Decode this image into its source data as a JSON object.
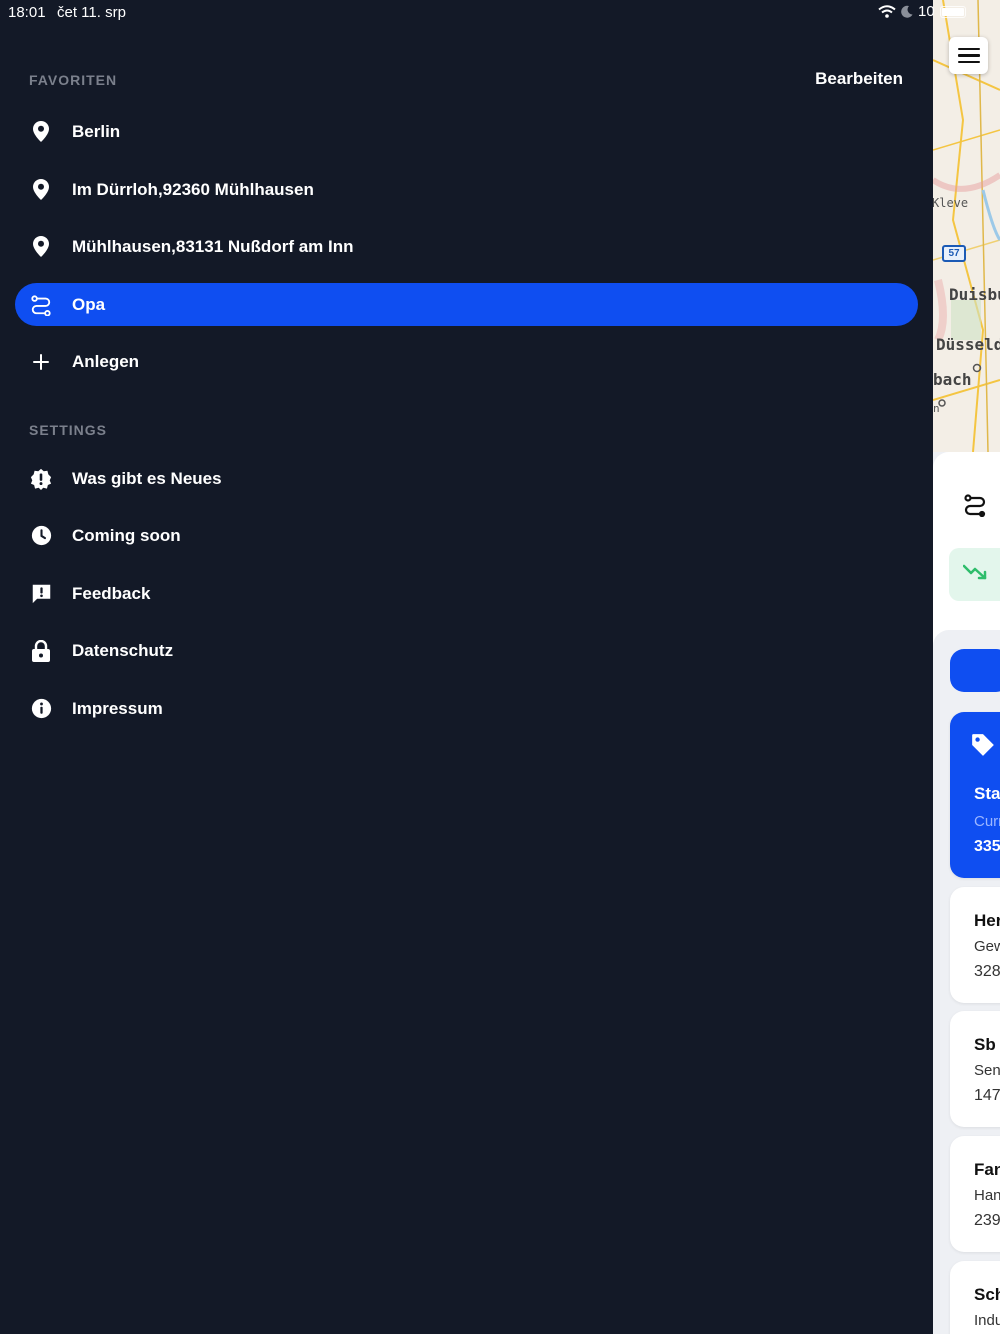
{
  "status_bar": {
    "time": "18:01",
    "date": "čet 11. srp",
    "battery_text": "10"
  },
  "favorites": {
    "header": "FAVORITEN",
    "edit_label": "Bearbeiten",
    "items": [
      {
        "label": "Berlin",
        "icon": "location-pin-icon"
      },
      {
        "label": "Im Dürrloh,92360 Mühlhausen",
        "icon": "location-pin-icon"
      },
      {
        "label": "Mühlhausen,83131 Nußdorf am Inn",
        "icon": "location-pin-icon"
      },
      {
        "label": "Opa",
        "icon": "route-icon",
        "active": true
      },
      {
        "label": "Anlegen",
        "icon": "plus-icon"
      }
    ]
  },
  "settings": {
    "header": "SETTINGS",
    "items": [
      {
        "label": "Was gibt es Neues",
        "icon": "new-badge-icon"
      },
      {
        "label": "Coming soon",
        "icon": "clock-icon"
      },
      {
        "label": "Feedback",
        "icon": "feedback-icon"
      },
      {
        "label": "Datenschutz",
        "icon": "lock-icon"
      },
      {
        "label": "Impressum",
        "icon": "info-icon"
      }
    ]
  },
  "background_app": {
    "map_labels": [
      "Kleve",
      "Duisbu",
      "Düsseld",
      "bach",
      "n"
    ],
    "road_number": "57",
    "cards": [
      {
        "title": "Sta",
        "sub": "Curr",
        "num": "335"
      },
      {
        "title": "Her",
        "sub": "Gew",
        "num": "328"
      },
      {
        "title": "Sb",
        "sub": "Sen",
        "num": "147,"
      },
      {
        "title": "Fan",
        "sub": "Han",
        "num": "239"
      },
      {
        "title": "Sch",
        "sub": "Indu",
        "num": ""
      }
    ]
  },
  "colors": {
    "drawer_bg": "#131927",
    "accent": "#0f4ef1",
    "section_header": "#7b808c"
  }
}
